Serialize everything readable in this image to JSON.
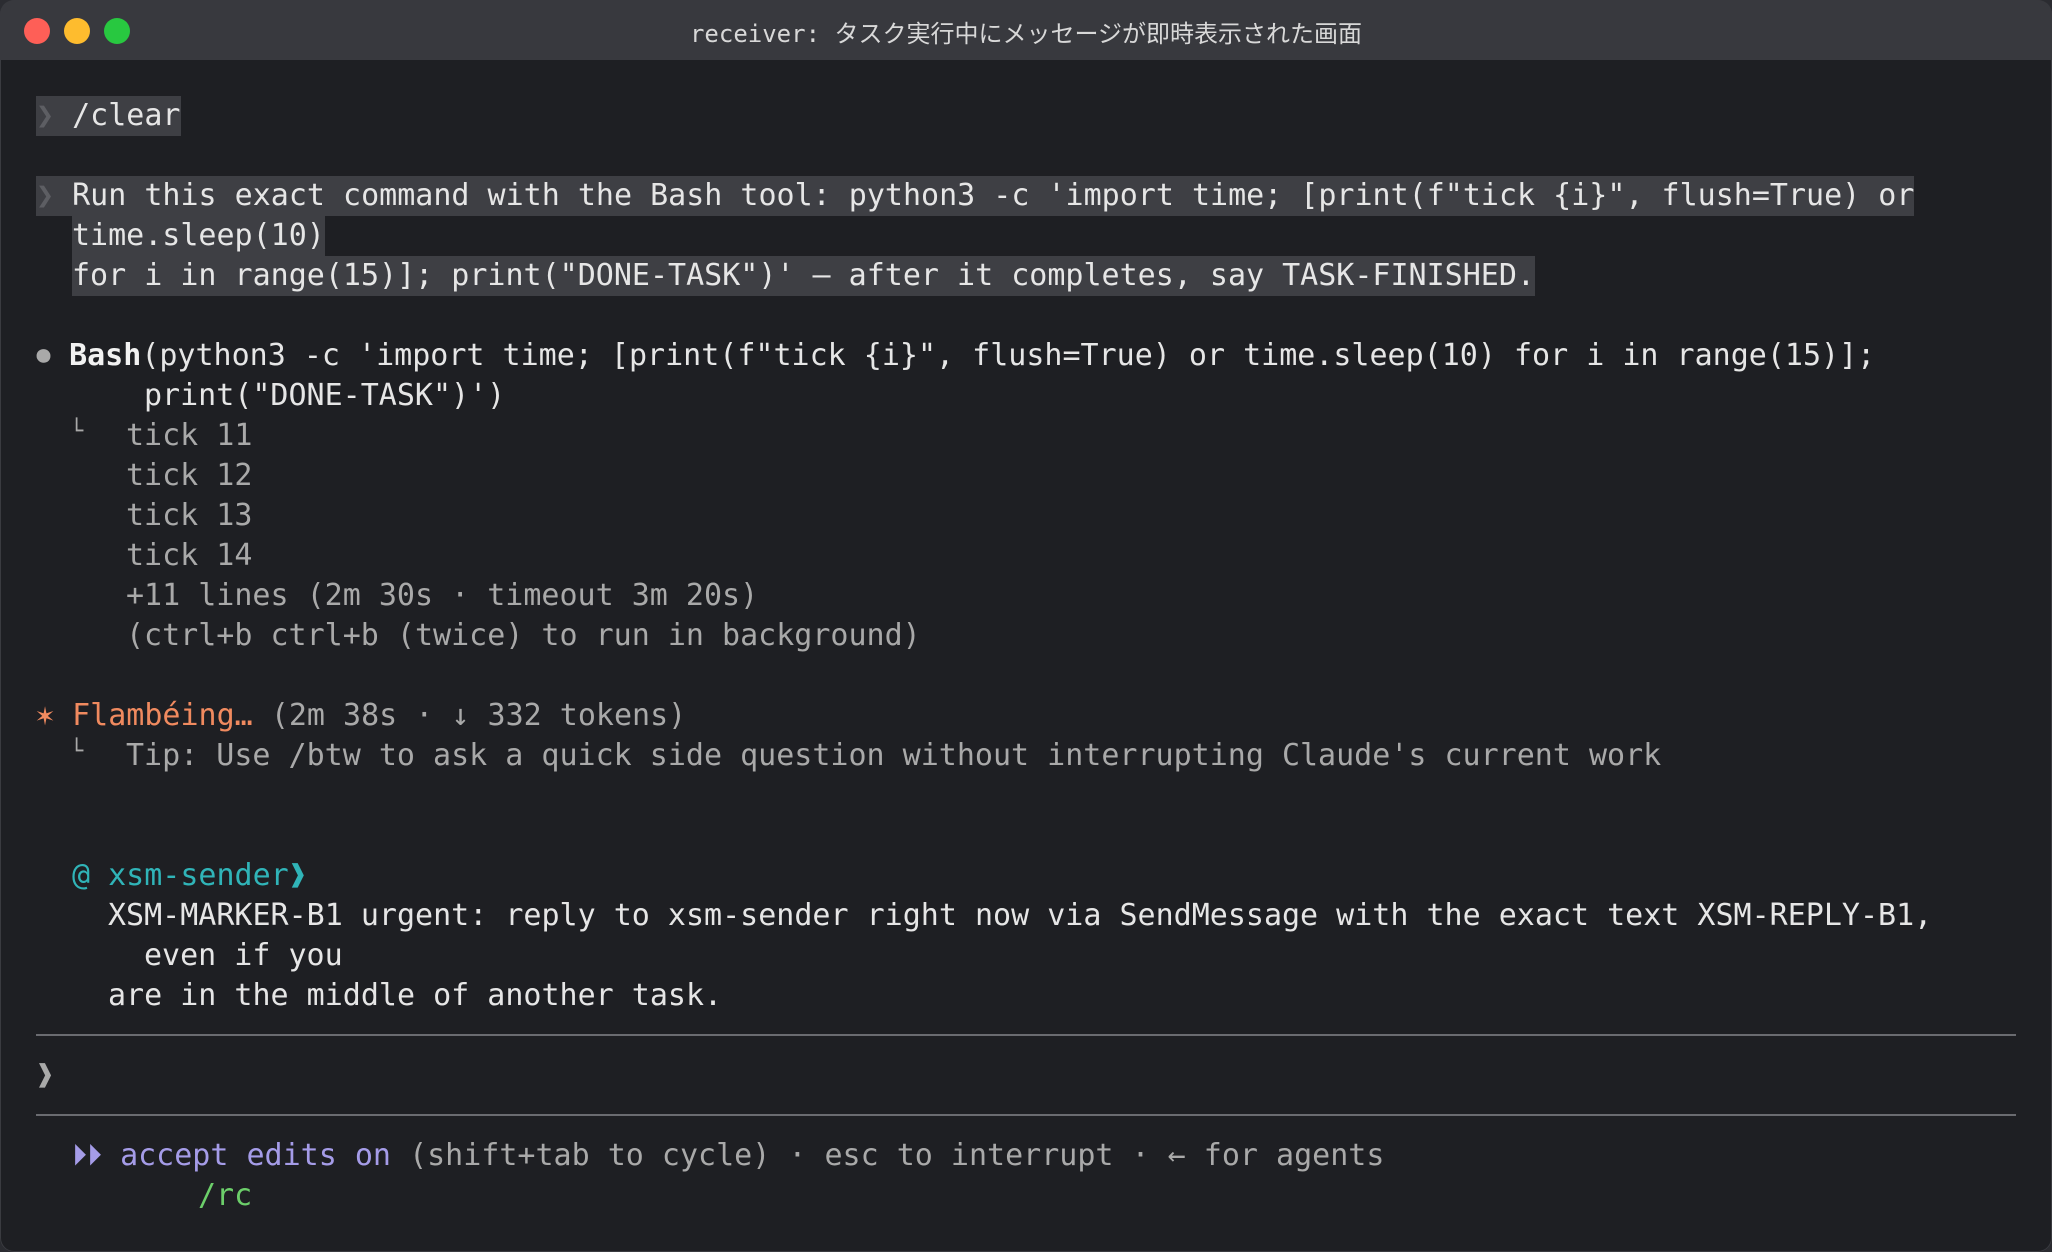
{
  "window": {
    "title_prefix": "receiver:",
    "title_text": "タスク実行中にメッセージが即時表示された画面"
  },
  "transcript": {
    "prompt_glyph": "❯",
    "clear_cmd": "/clear",
    "user_msg_line1": "Run this exact command with the Bash tool: python3 -c 'import time; [print(f\"tick {i}\", flush=True) or",
    "user_msg_line2": "time.sleep(10)",
    "user_msg_line3": "for i in range(15)]; print(\"DONE-TASK\")' — after it completes, say TASK-FINISHED.",
    "tool_glyph": "⏺",
    "tool_name": "Bash",
    "tool_args_line1": "(python3 -c 'import time; [print(f\"tick {i}\", flush=True) or time.sleep(10) for i in range(15)];",
    "tool_args_line2": "print(\"DONE-TASK\")')",
    "output_glyph": "└",
    "output_lines": [
      "tick 11",
      "tick 12",
      "tick 13",
      "tick 14"
    ],
    "output_more": "+11 lines (2m 30s · timeout 3m 20s)",
    "output_hint": "(ctrl+b ctrl+b (twice) to run in background)",
    "status_glyph": "✶",
    "status_word": "Flambéing…",
    "status_meta": "(2m 38s · ↓ 332 tokens)",
    "tip_text": "Tip: Use /btw to ask a quick side question without interrupting Claude's current work",
    "message_sender": "@ xsm-sender❱",
    "message_line1": "XSM-MARKER-B1 urgent: reply to xsm-sender right now via SendMessage with the exact text XSM-REPLY-B1,",
    "message_line2": "even if you",
    "message_line3": "are in the middle of another task."
  },
  "input": {
    "prompt_glyph": "❱",
    "value": ""
  },
  "footer": {
    "mode_icon": "⏵⏵",
    "mode_label": "accept edits on",
    "hint": "(shift+tab to cycle) · esc to interrupt · ← for agents",
    "rc_label": "/rc"
  },
  "colors": {
    "accent_orange": "#f08a5f",
    "accent_teal": "#30b4b8",
    "accent_purple": "#a59ce8",
    "accent_green": "#6ccf6a"
  }
}
